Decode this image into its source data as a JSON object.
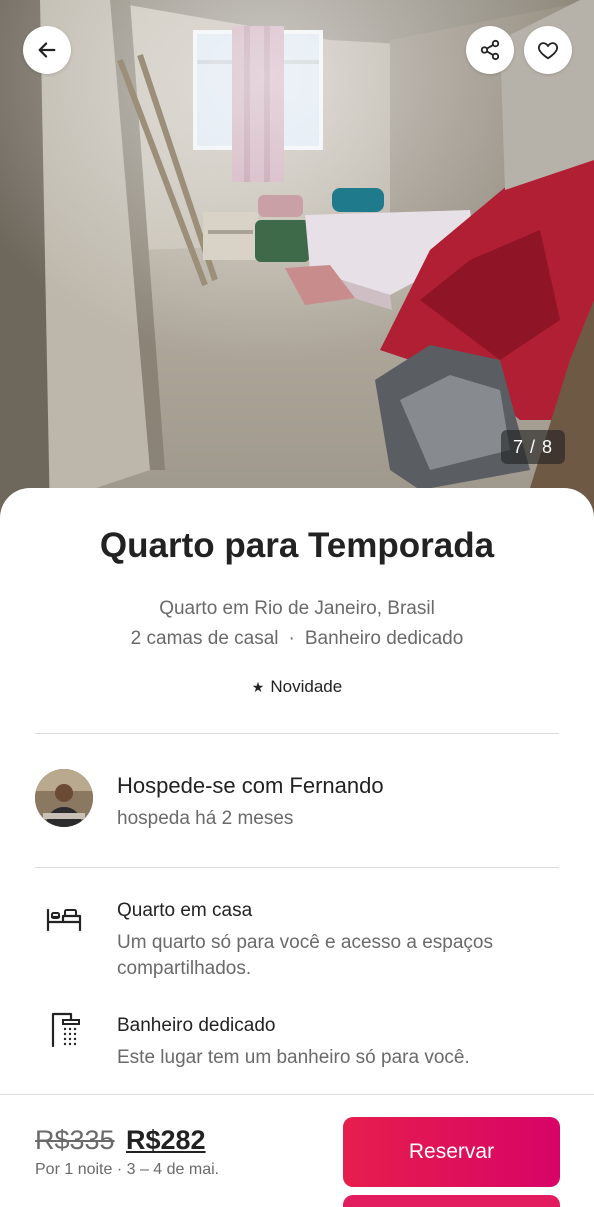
{
  "gallery": {
    "counter": "7 / 8",
    "back_icon": "arrow-left-icon",
    "share_icon": "share-icon",
    "favorite_icon": "heart-icon"
  },
  "listing": {
    "title": "Quarto para Temporada",
    "location": "Quarto em Rio de Janeiro, Brasil",
    "beds": "2 camas de casal",
    "separator": "·",
    "bath": "Banheiro dedicado",
    "badge": "Novidade"
  },
  "host": {
    "title": "Hospede-se com Fernando",
    "subtitle": "hospeda há 2 meses"
  },
  "features": [
    {
      "icon": "bed-icon",
      "title": "Quarto em casa",
      "description": "Um quarto só para você e acesso a espaços compartilhados."
    },
    {
      "icon": "shower-icon",
      "title": "Banheiro dedicado",
      "description": "Este lugar tem um banheiro só para você."
    }
  ],
  "footer": {
    "old_price": "R$335",
    "new_price": "R$282",
    "note": "Por 1 noite · 3 – 4 de mai.",
    "reserve_label": "Reservar"
  },
  "colors": {
    "accent": "#e31c5f",
    "text": "#222222",
    "muted": "#6a6a6a"
  }
}
